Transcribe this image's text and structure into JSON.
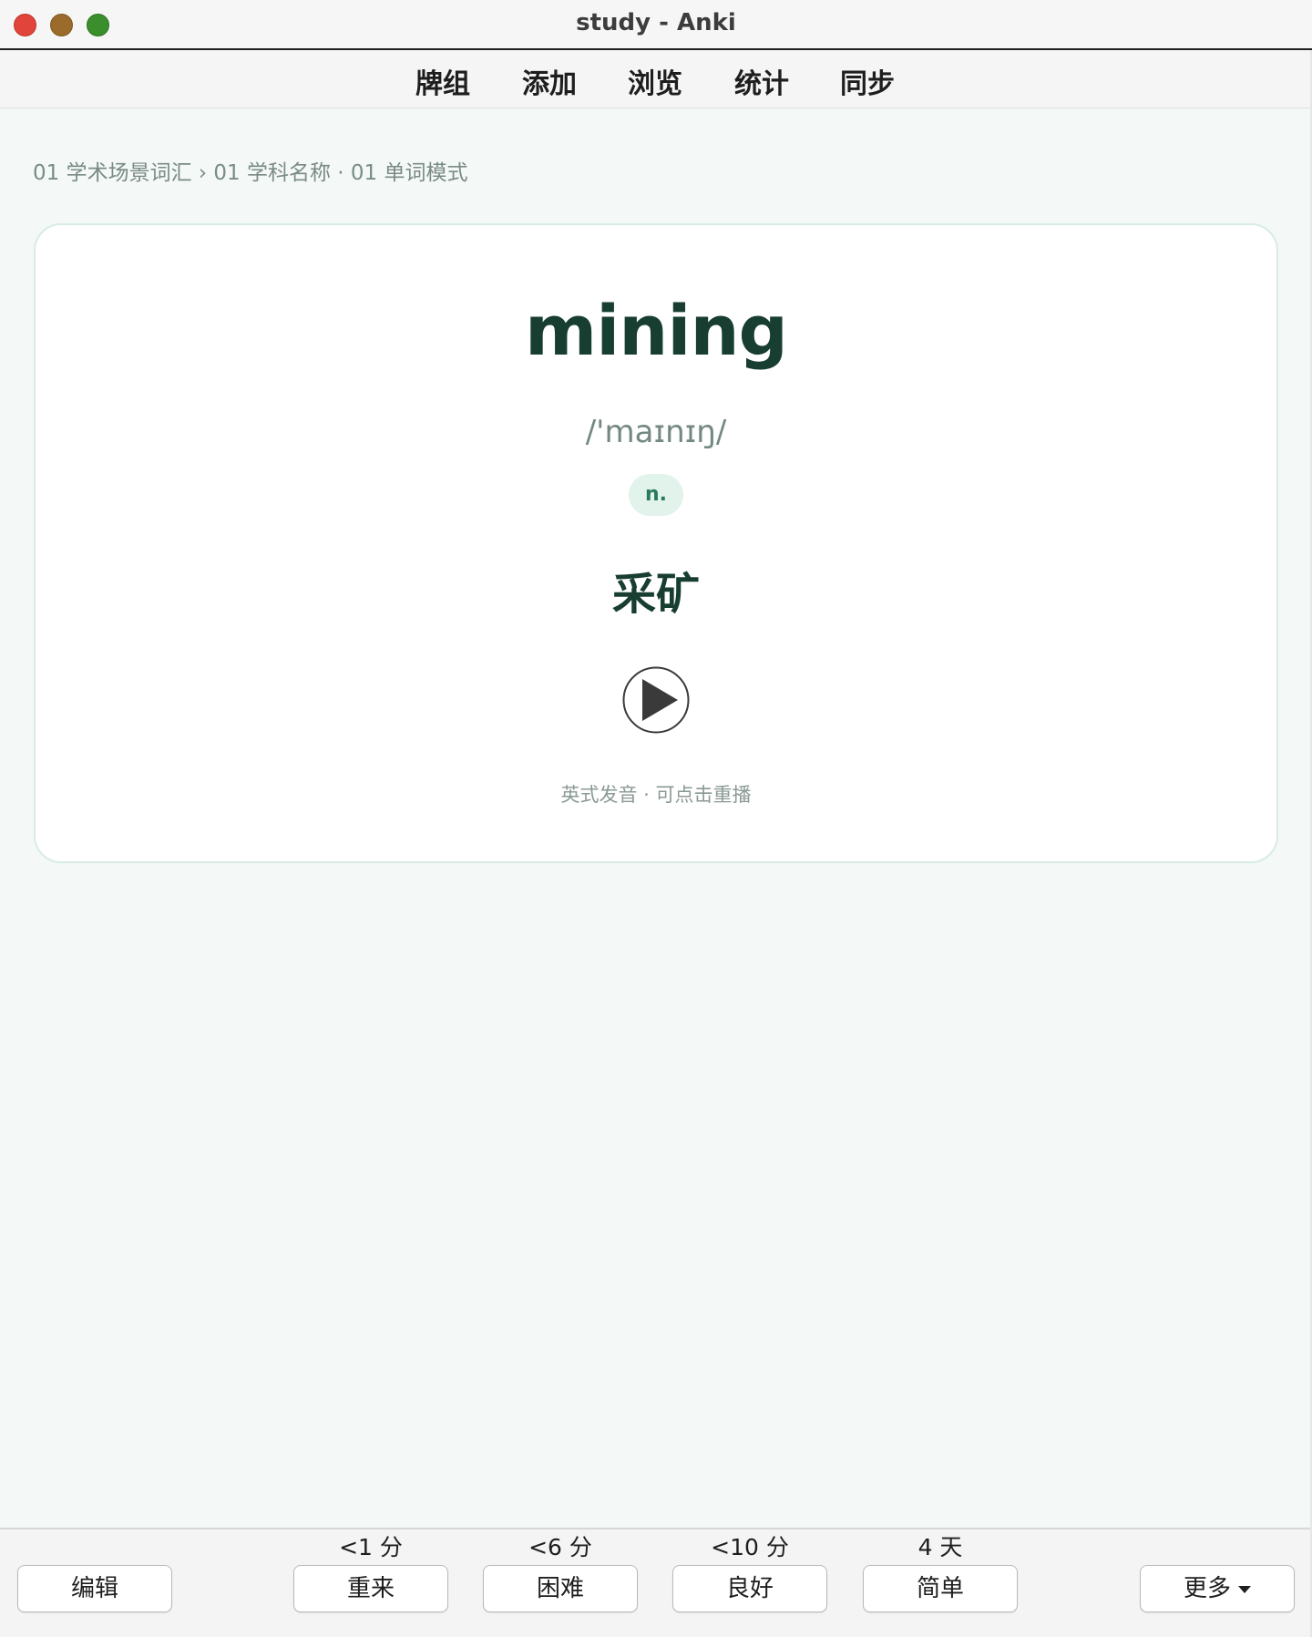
{
  "window": {
    "title": "study - Anki"
  },
  "toolbar": {
    "items": [
      {
        "label": "牌组"
      },
      {
        "label": "添加"
      },
      {
        "label": "浏览"
      },
      {
        "label": "统计"
      },
      {
        "label": "同步"
      }
    ]
  },
  "breadcrumb": {
    "text": "01 学术场景词汇 › 01 学科名称 · 01 单词模式"
  },
  "card": {
    "word": "mining",
    "ipa": "/'maɪnɪŋ/",
    "part_of_speech": "n.",
    "meaning": "采矿",
    "play_icon": "play-circle-icon",
    "audio_hint": "英式发音 · 可点击重播"
  },
  "answer_bar": {
    "edit_label": "编辑",
    "more_label": "更多",
    "ease_buttons": [
      {
        "label": "重来",
        "interval": "<1 分"
      },
      {
        "label": "困难",
        "interval": "<6 分"
      },
      {
        "label": "良好",
        "interval": "<10 分"
      },
      {
        "label": "简单",
        "interval": "4 天"
      }
    ]
  },
  "colors": {
    "accent_dark_green": "#173e31",
    "badge_bg": "#e2f3ec",
    "badge_text": "#2b7a5c",
    "page_bg": "#f4f8f7"
  }
}
